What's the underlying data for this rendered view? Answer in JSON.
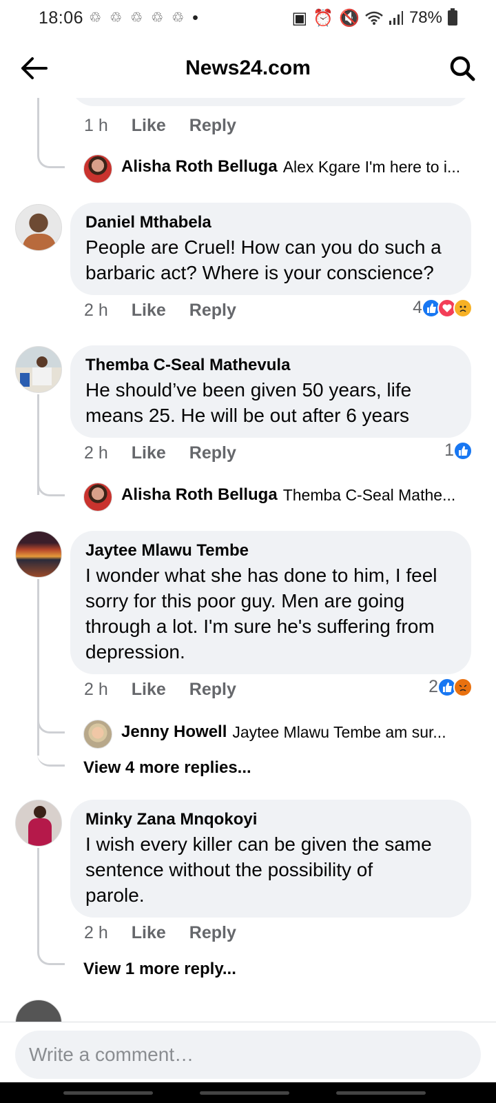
{
  "status_bar": {
    "time": "18:06",
    "battery": "78%",
    "dot": "•"
  },
  "header": {
    "title": "News24.com"
  },
  "top_partial": {
    "time": "1 h",
    "like_label": "Like",
    "reply_label": "Reply"
  },
  "reply_alisha_1": {
    "author": "Alisha Roth Belluga",
    "preview": "Alex Kgare I'm here to i..."
  },
  "comments": [
    {
      "author": "Daniel Mthabela",
      "lines": [
        "People are Cruel! How can you do such a",
        "barbaric act? Where is your conscience?"
      ],
      "time": "2 h",
      "like_label": "Like",
      "reply_label": "Reply",
      "reaction_count": "4"
    },
    {
      "author": "Themba C-Seal Mathevula",
      "lines": [
        "He should’ve been given 50 years, life",
        "means 25. He will be out after 6 years"
      ],
      "time": "2 h",
      "like_label": "Like",
      "reply_label": "Reply",
      "reaction_count": "1",
      "reply": {
        "author": "Alisha Roth Belluga",
        "preview": "Themba C-Seal Mathe..."
      }
    },
    {
      "author": "Jaytee Mlawu Tembe",
      "lines": [
        "I wonder what she has done to him, I feel",
        "sorry for this poor guy. Men are going",
        "through a lot. I'm sure he's suffering from",
        "depression."
      ],
      "time": "2 h",
      "like_label": "Like",
      "reply_label": "Reply",
      "reaction_count": "2",
      "reply": {
        "author": "Jenny Howell",
        "preview": "Jaytee Mlawu Tembe am sur..."
      },
      "view_more": "View 4 more replies..."
    },
    {
      "author": "Minky Zana Mnqokoyi",
      "lines": [
        "I wish every killer can be given the same",
        "sentence without the possibility of",
        "parole."
      ],
      "time": "2 h",
      "like_label": "Like",
      "reply_label": "Reply",
      "view_more": "View 1 more reply..."
    }
  ],
  "composer": {
    "placeholder": "Write a comment…"
  },
  "colors": {
    "bubble": "#f0f2f5",
    "like": "#1877f2",
    "love": "#f33e58",
    "sad": "#f7b125",
    "angry": "#e9710f",
    "muted": "#65676b"
  }
}
